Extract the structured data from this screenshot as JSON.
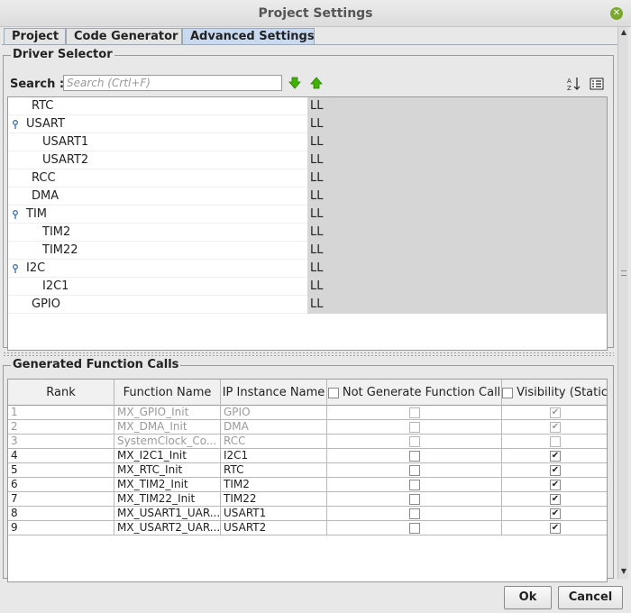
{
  "window": {
    "title": "Project Settings",
    "close_icon": "close-icon"
  },
  "tabs": [
    {
      "label": "Project",
      "active": false
    },
    {
      "label": "Code Generator",
      "active": false
    },
    {
      "label": "Advanced Settings",
      "active": true
    }
  ],
  "driver_selector": {
    "title": "Driver Selector",
    "search_label": "Search :",
    "search_placeholder": "Search (Crtl+F)",
    "search_value": "",
    "icons": [
      "arrow-down-icon",
      "arrow-up-icon",
      "sort-az-icon",
      "list-view-icon"
    ],
    "rows": [
      {
        "name": "RTC",
        "value": "LL",
        "level": 0,
        "expandable": false
      },
      {
        "name": "USART",
        "value": "LL",
        "level": 0,
        "expandable": true
      },
      {
        "name": "USART1",
        "value": "LL",
        "level": 1,
        "expandable": false
      },
      {
        "name": "USART2",
        "value": "LL",
        "level": 1,
        "expandable": false
      },
      {
        "name": "RCC",
        "value": "LL",
        "level": 0,
        "expandable": false
      },
      {
        "name": "DMA",
        "value": "LL",
        "level": 0,
        "expandable": false
      },
      {
        "name": "TIM",
        "value": "LL",
        "level": 0,
        "expandable": true
      },
      {
        "name": "TIM2",
        "value": "LL",
        "level": 1,
        "expandable": false
      },
      {
        "name": "TIM22",
        "value": "LL",
        "level": 1,
        "expandable": false
      },
      {
        "name": "I2C",
        "value": "LL",
        "level": 0,
        "expandable": true
      },
      {
        "name": "I2C1",
        "value": "LL",
        "level": 1,
        "expandable": false
      },
      {
        "name": "GPIO",
        "value": "LL",
        "level": 0,
        "expandable": false
      }
    ]
  },
  "generated_calls": {
    "title": "Generated Function Calls",
    "columns": {
      "rank": "Rank",
      "function": "Function Name",
      "ip": "IP Instance Name",
      "not_generate": "Not Generate Function Call",
      "visibility": "Visibility (Static)"
    },
    "header_checks": {
      "not_generate": false,
      "visibility": false
    },
    "rows": [
      {
        "rank": "1",
        "function": "MX_GPIO_Init",
        "ip": "GPIO",
        "not_generate": false,
        "visibility": true,
        "disabled": true
      },
      {
        "rank": "2",
        "function": "MX_DMA_Init",
        "ip": "DMA",
        "not_generate": false,
        "visibility": true,
        "disabled": true
      },
      {
        "rank": "3",
        "function": "SystemClock_Co...",
        "ip": "RCC",
        "not_generate": false,
        "visibility": false,
        "disabled": true
      },
      {
        "rank": "4",
        "function": "MX_I2C1_Init",
        "ip": "I2C1",
        "not_generate": false,
        "visibility": true,
        "disabled": false
      },
      {
        "rank": "5",
        "function": "MX_RTC_Init",
        "ip": "RTC",
        "not_generate": false,
        "visibility": true,
        "disabled": false
      },
      {
        "rank": "6",
        "function": "MX_TIM2_Init",
        "ip": "TIM2",
        "not_generate": false,
        "visibility": true,
        "disabled": false
      },
      {
        "rank": "7",
        "function": "MX_TIM22_Init",
        "ip": "TIM22",
        "not_generate": false,
        "visibility": true,
        "disabled": false
      },
      {
        "rank": "8",
        "function": "MX_USART1_UAR...",
        "ip": "USART1",
        "not_generate": false,
        "visibility": true,
        "disabled": false
      },
      {
        "rank": "9",
        "function": "MX_USART2_UAR...",
        "ip": "USART2",
        "not_generate": false,
        "visibility": true,
        "disabled": false
      }
    ]
  },
  "buttons": {
    "ok": "Ok",
    "cancel": "Cancel"
  },
  "colors": {
    "active_tab": "#c9daf0",
    "value_cell": "#d6d6d6",
    "arrow_green": "#3fb400"
  }
}
